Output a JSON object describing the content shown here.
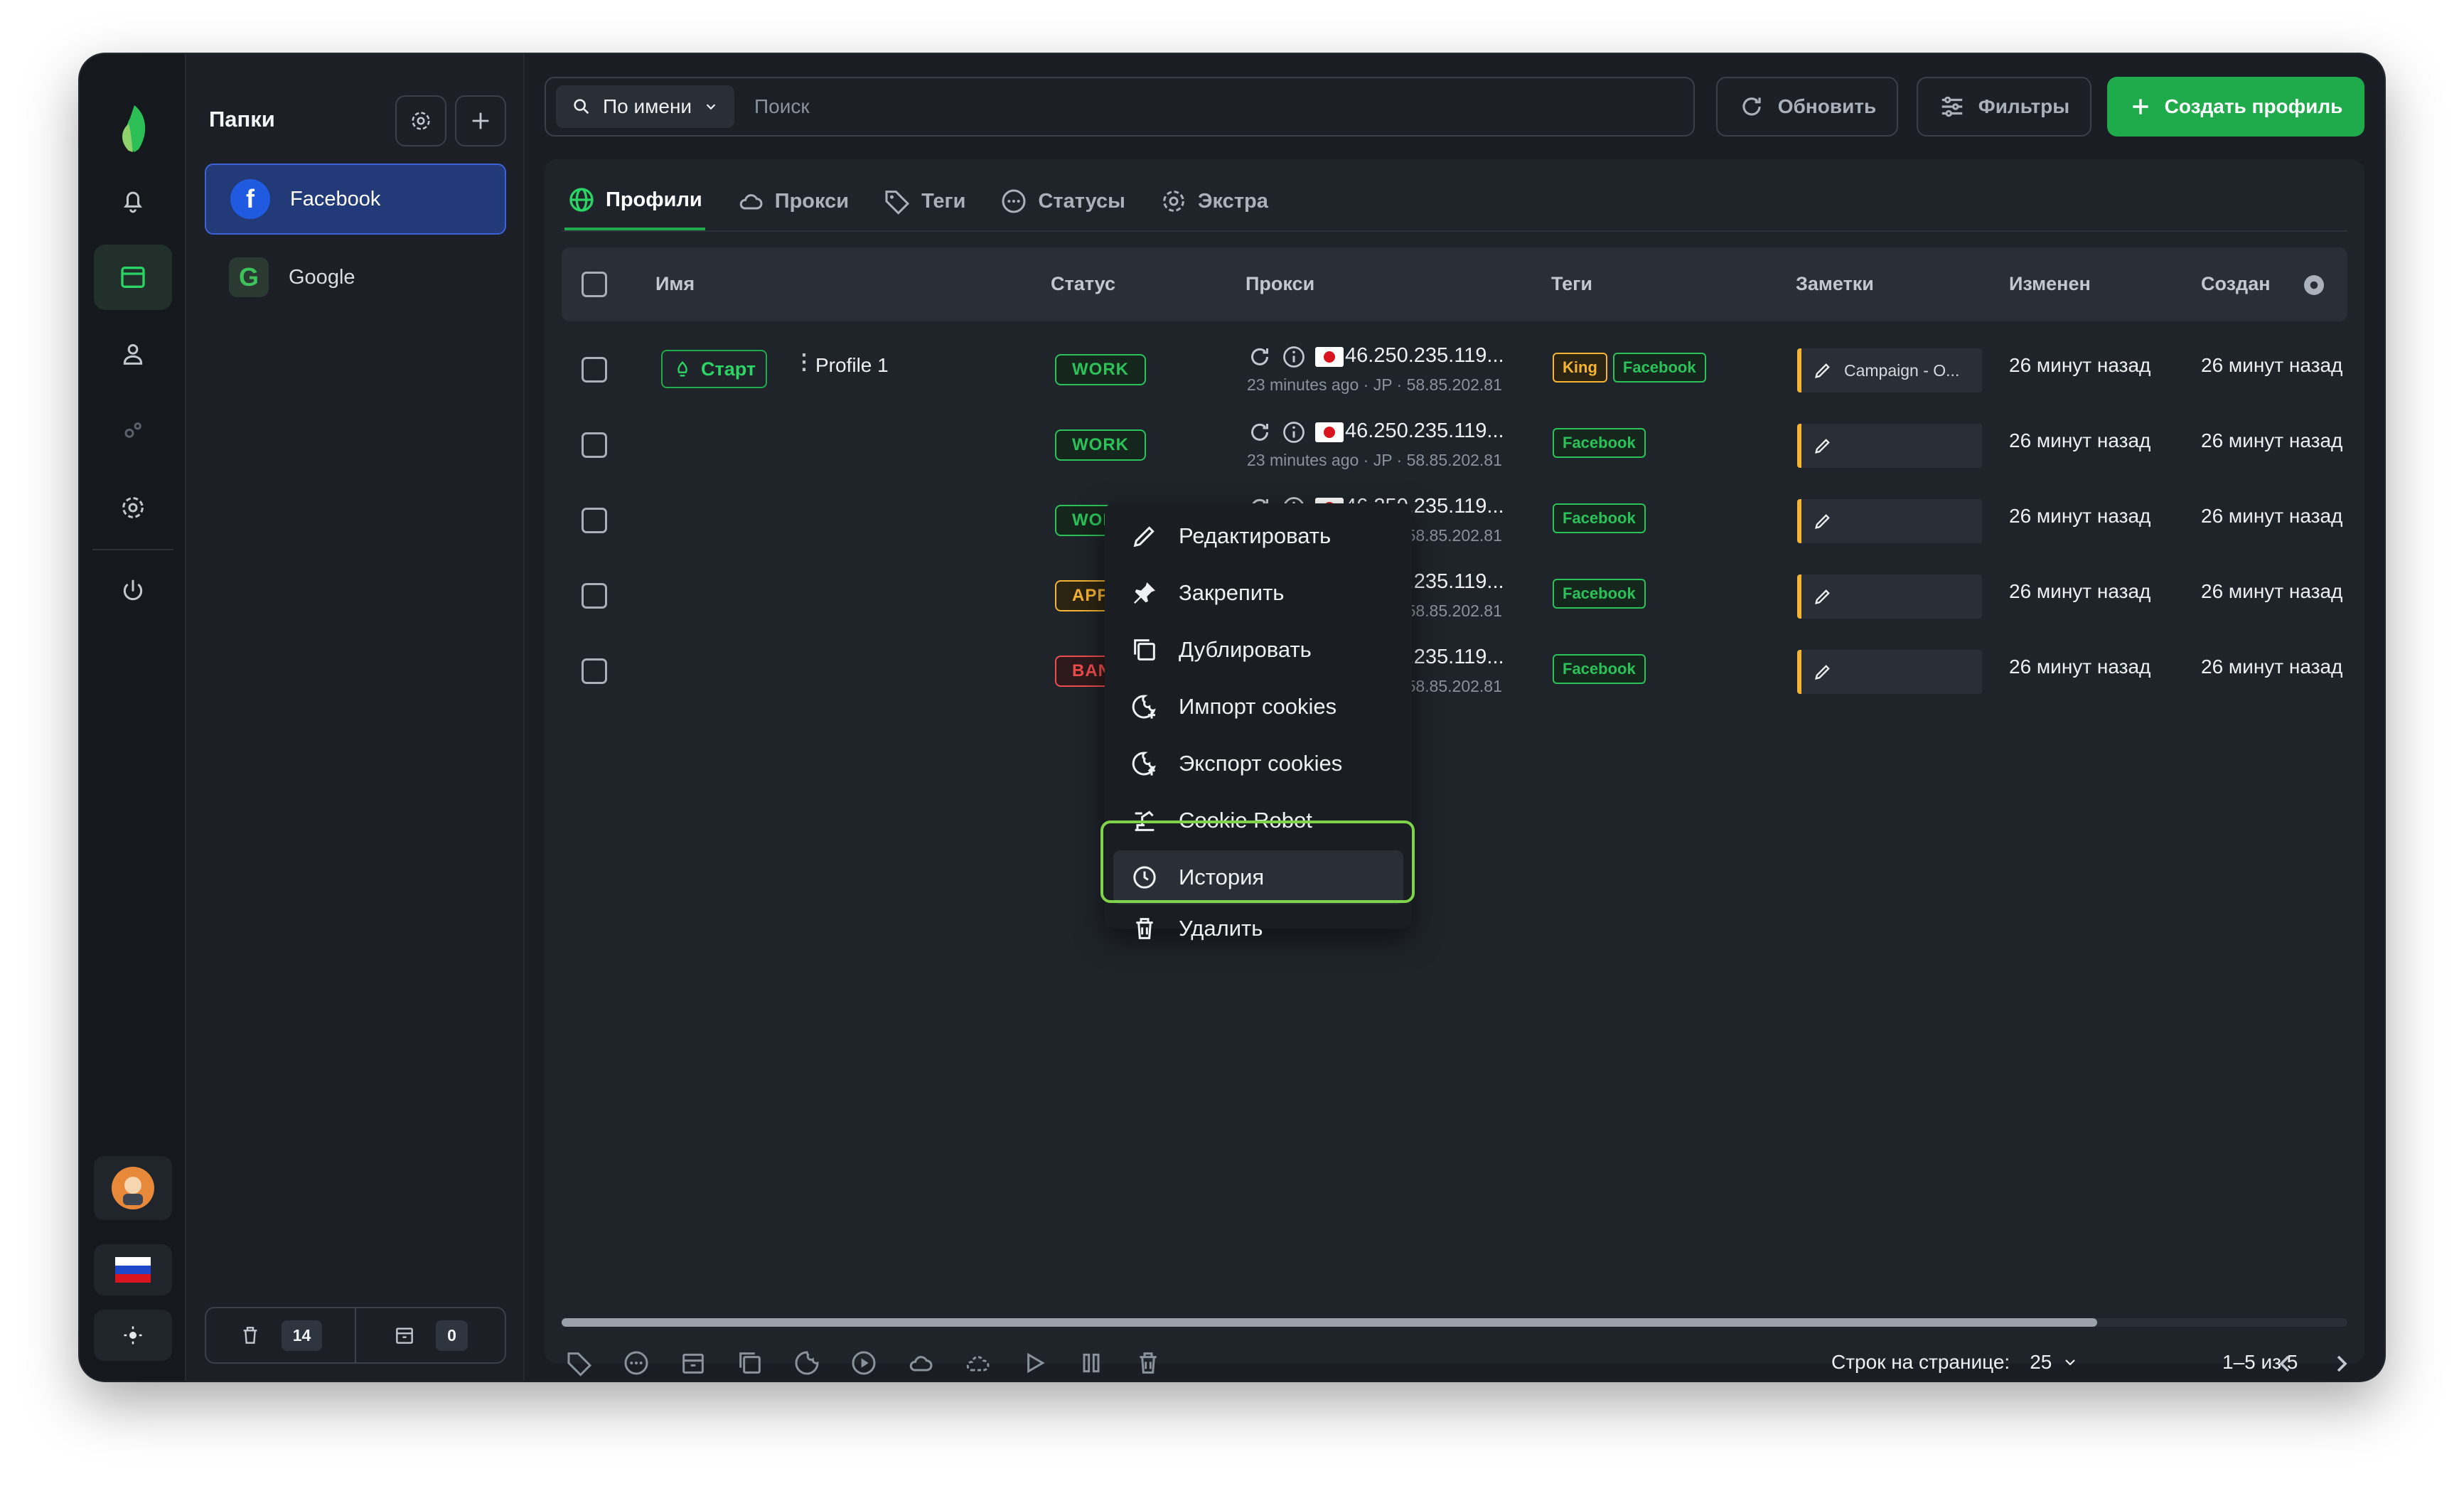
{
  "folders": {
    "title": "Папки",
    "items": [
      {
        "label": "Facebook",
        "active": true,
        "icon": "facebook-icon"
      },
      {
        "label": "Google",
        "active": false,
        "icon": "google-icon"
      }
    ],
    "trash_count": "14",
    "archive_count": "0"
  },
  "search": {
    "mode_label": "По имени",
    "placeholder": "Поиск"
  },
  "toolbar": {
    "refresh_label": "Обновить",
    "filters_label": "Фильтры",
    "create_label": "Создать профиль"
  },
  "tabs": [
    {
      "label": "Профили",
      "active": true
    },
    {
      "label": "Прокси",
      "active": false
    },
    {
      "label": "Теги",
      "active": false
    },
    {
      "label": "Статусы",
      "active": false
    },
    {
      "label": "Экстра",
      "active": false
    }
  ],
  "table": {
    "headers": [
      "Имя",
      "Статус",
      "Прокси",
      "Теги",
      "Заметки",
      "Изменен",
      "Создан"
    ],
    "start_label": "Старт",
    "profile_name": "Profile 1",
    "rows": [
      {
        "status": "WORK",
        "status_kind": "work",
        "proxy_ip": "46.250.235.119...",
        "proxy_sub": "23 minutes ago · JP · 58.85.202.81",
        "tags": [
          "King",
          "Facebook"
        ],
        "note": "Campaign - O...",
        "modified": "26 минут назад",
        "created": "26 минут назад"
      },
      {
        "status": "WORK",
        "status_kind": "work",
        "proxy_ip": "46.250.235.119...",
        "proxy_sub": "23 minutes ago · JP · 58.85.202.81",
        "tags": [
          "Facebook"
        ],
        "note": "",
        "modified": "26 минут назад",
        "created": "26 минут назад"
      },
      {
        "status": "WORK",
        "status_kind": "work",
        "proxy_ip": "46.250.235.119...",
        "proxy_sub": "23 minutes ago · JP · 58.85.202.81",
        "tags": [
          "Facebook"
        ],
        "note": "",
        "modified": "26 минут назад",
        "created": "26 минут назад"
      },
      {
        "status": "APPEAL",
        "status_kind": "appeal",
        "proxy_ip": "46.250.235.119...",
        "proxy_sub": "23 minutes ago · JP · 58.85.202.81",
        "tags": [
          "Facebook"
        ],
        "note": "",
        "modified": "26 минут назад",
        "created": "26 минут назад"
      },
      {
        "status": "BAN",
        "status_kind": "ban",
        "proxy_ip": "46.250.235.119...",
        "proxy_sub": "23 minutes ago · JP · 58.85.202.81",
        "tags": [
          "Facebook"
        ],
        "note": "",
        "modified": "26 минут назад",
        "created": "26 минут назад"
      }
    ]
  },
  "context_menu": {
    "items": [
      {
        "label": "Редактировать",
        "icon": "pencil-icon"
      },
      {
        "label": "Закрепить",
        "icon": "pin-icon"
      },
      {
        "label": "Дублировать",
        "icon": "duplicate-icon"
      },
      {
        "label": "Импорт cookies",
        "icon": "cookie-import-icon"
      },
      {
        "label": "Экспорт cookies",
        "icon": "cookie-export-icon"
      },
      {
        "label": "Cookie Robot",
        "icon": "robot-icon"
      },
      {
        "label": "История",
        "icon": "clock-icon",
        "highlighted": true
      },
      {
        "label": "Удалить",
        "icon": "trash-icon"
      }
    ]
  },
  "pagination": {
    "rows_per_page_label": "Строк на странице:",
    "rows_per_page_value": "25",
    "range": "1–5 из 5"
  },
  "colors": {
    "accent_green": "#1faa4c",
    "work": "#2bc25a",
    "appeal": "#f5b431",
    "ban": "#ef4d4d",
    "active_folder": "#223a78"
  }
}
